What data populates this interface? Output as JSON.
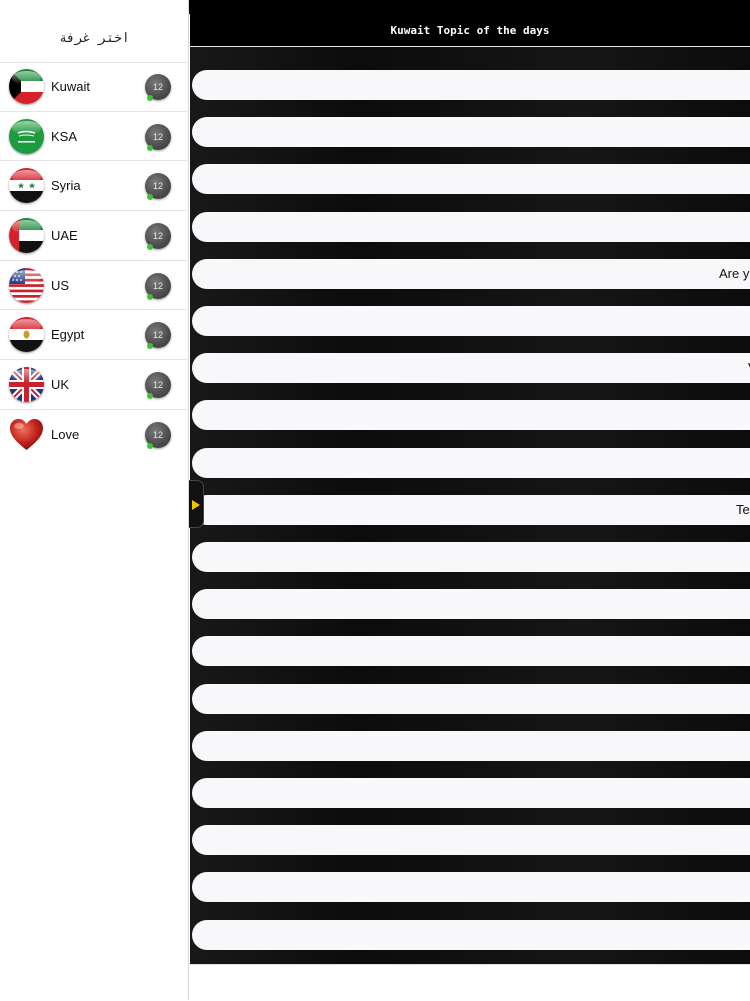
{
  "sidebar": {
    "title": "اختر غرفة",
    "rooms": [
      {
        "name": "Kuwait",
        "count": "12",
        "flag": "kuwait-flag-icon"
      },
      {
        "name": "KSA",
        "count": "12",
        "flag": "saudi-flag-icon"
      },
      {
        "name": "Syria",
        "count": "12",
        "flag": "syria-flag-icon"
      },
      {
        "name": "UAE",
        "count": "12",
        "flag": "uae-flag-icon"
      },
      {
        "name": "US",
        "count": "12",
        "flag": "us-flag-icon"
      },
      {
        "name": "Egypt",
        "count": "12",
        "flag": "egypt-flag-icon"
      },
      {
        "name": "UK",
        "count": "12",
        "flag": "uk-flag-icon"
      },
      {
        "name": "Love",
        "count": "12",
        "flag": "heart-icon"
      }
    ]
  },
  "chat": {
    "title": "Kuwait Topic of the days",
    "messages": [
      "",
      "",
      "",
      "",
      "Are yo",
      "",
      "V",
      "",
      "",
      "Tel",
      "",
      "",
      "",
      "",
      "",
      "",
      "",
      "",
      ""
    ]
  },
  "colors": {
    "online": "#3fc23a",
    "handle_arrow": "#f2c200",
    "badge": "#555555"
  }
}
